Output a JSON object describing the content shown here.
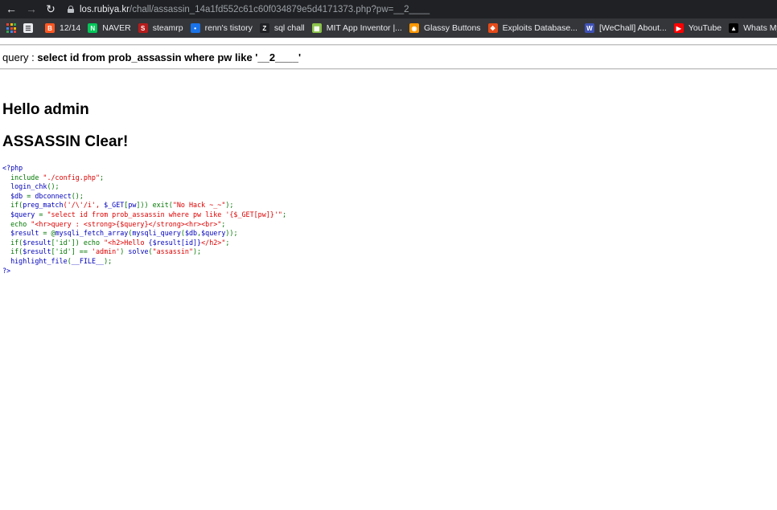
{
  "browser": {
    "back_icon": "arrow-left",
    "forward_icon": "arrow-right",
    "reload_icon": "reload",
    "url_host": "los.rubiya.kr",
    "url_path": "/chall/assassin_14a1fd552c61c60f034879e5d4171373.php?pw=__2____"
  },
  "bookmarks": [
    {
      "label": "",
      "icon": "page-icon",
      "color": "#e8eaed",
      "glyph": "☰"
    },
    {
      "label": "12/14",
      "icon": "blogger-icon",
      "color": "#ff5722",
      "glyph": "B"
    },
    {
      "label": "NAVER",
      "icon": "naver-icon",
      "color": "#03c75a",
      "glyph": "N"
    },
    {
      "label": "steamrp",
      "icon": "steamrp-icon",
      "color": "#b71c1c",
      "glyph": "S"
    },
    {
      "label": "renn's tistory",
      "icon": "tistory-icon",
      "color": "#1a73e8",
      "glyph": "•"
    },
    {
      "label": "sql chall",
      "icon": "zeta-icon",
      "color": "#202124",
      "glyph": "Z"
    },
    {
      "label": "MIT App Inventor |...",
      "icon": "mit-icon",
      "color": "#8bc34a",
      "glyph": "▦"
    },
    {
      "label": "Glassy Buttons",
      "icon": "glassy-icon",
      "color": "#ff9800",
      "glyph": "◉"
    },
    {
      "label": "Exploits Database...",
      "icon": "exploitdb-icon",
      "color": "#e64a19",
      "glyph": "❖"
    },
    {
      "label": "[WeChall] About...",
      "icon": "wechall-icon",
      "color": "#3f51b5",
      "glyph": "W"
    },
    {
      "label": "YouTube",
      "icon": "youtube-icon",
      "color": "#ff0000",
      "glyph": "▶"
    },
    {
      "label": "Whats My IP A",
      "icon": "whatsmyip-icon",
      "color": "#000000",
      "glyph": "▲"
    }
  ],
  "page": {
    "query_label": "query : ",
    "query_sql": "select id from prob_assassin where pw like '__2____'",
    "hello": "Hello admin",
    "clear": "ASSASSIN Clear!",
    "source_lines": [
      [
        {
          "t": "<?php",
          "c": "def"
        }
      ],
      [
        {
          "t": "  include ",
          "c": "kw"
        },
        {
          "t": "\"./config.php\"",
          "c": "str"
        },
        {
          "t": ";",
          "c": "kw"
        }
      ],
      [
        {
          "t": "  login_chk",
          "c": "def"
        },
        {
          "t": "();",
          "c": "kw"
        }
      ],
      [
        {
          "t": "  $db ",
          "c": "def"
        },
        {
          "t": "= ",
          "c": "kw"
        },
        {
          "t": "dbconnect",
          "c": "def"
        },
        {
          "t": "();",
          "c": "kw"
        }
      ],
      [
        {
          "t": "  if(",
          "c": "kw"
        },
        {
          "t": "preg_match",
          "c": "def"
        },
        {
          "t": "('/\\'/i', ",
          "c": "str"
        },
        {
          "t": "$_GET",
          "c": "def"
        },
        {
          "t": "[",
          "c": "kw"
        },
        {
          "t": "pw",
          "c": "def"
        },
        {
          "t": "])) exit(",
          "c": "kw"
        },
        {
          "t": "\"No Hack ~_~\"",
          "c": "str"
        },
        {
          "t": ");",
          "c": "kw"
        }
      ],
      [
        {
          "t": "  $query ",
          "c": "def"
        },
        {
          "t": "= ",
          "c": "kw"
        },
        {
          "t": "\"select id from prob_assassin where pw like '{$_GET[pw]}'\"",
          "c": "str"
        },
        {
          "t": ";",
          "c": "kw"
        }
      ],
      [
        {
          "t": "  echo ",
          "c": "kw"
        },
        {
          "t": "\"<hr>query : <strong>{$query}</strong><hr><br>\"",
          "c": "str"
        },
        {
          "t": ";",
          "c": "kw"
        }
      ],
      [
        {
          "t": "  $result ",
          "c": "def"
        },
        {
          "t": "= @",
          "c": "kw"
        },
        {
          "t": "mysqli_fetch_array",
          "c": "def"
        },
        {
          "t": "(",
          "c": "kw"
        },
        {
          "t": "mysqli_query",
          "c": "def"
        },
        {
          "t": "(",
          "c": "kw"
        },
        {
          "t": "$db",
          "c": "def"
        },
        {
          "t": ",",
          "c": "kw"
        },
        {
          "t": "$query",
          "c": "def"
        },
        {
          "t": "));",
          "c": "kw"
        }
      ],
      [
        {
          "t": "  if(",
          "c": "kw"
        },
        {
          "t": "$result",
          "c": "def"
        },
        {
          "t": "['id']) echo ",
          "c": "kw"
        },
        {
          "t": "\"<h2>Hello ",
          "c": "str"
        },
        {
          "t": "{$result[id]}",
          "c": "def"
        },
        {
          "t": "</h2>\"",
          "c": "str"
        },
        {
          "t": ";",
          "c": "kw"
        }
      ],
      [
        {
          "t": "  if(",
          "c": "kw"
        },
        {
          "t": "$result",
          "c": "def"
        },
        {
          "t": "['id'] == ",
          "c": "kw"
        },
        {
          "t": "'admin'",
          "c": "str"
        },
        {
          "t": ") ",
          "c": "kw"
        },
        {
          "t": "solve",
          "c": "def"
        },
        {
          "t": "(",
          "c": "kw"
        },
        {
          "t": "\"assassin\"",
          "c": "str"
        },
        {
          "t": ");",
          "c": "kw"
        }
      ],
      [
        {
          "t": "  highlight_file",
          "c": "def"
        },
        {
          "t": "(",
          "c": "kw"
        },
        {
          "t": "__FILE__",
          "c": "def"
        },
        {
          "t": ");",
          "c": "kw"
        }
      ],
      [
        {
          "t": "?>",
          "c": "def"
        }
      ]
    ]
  }
}
